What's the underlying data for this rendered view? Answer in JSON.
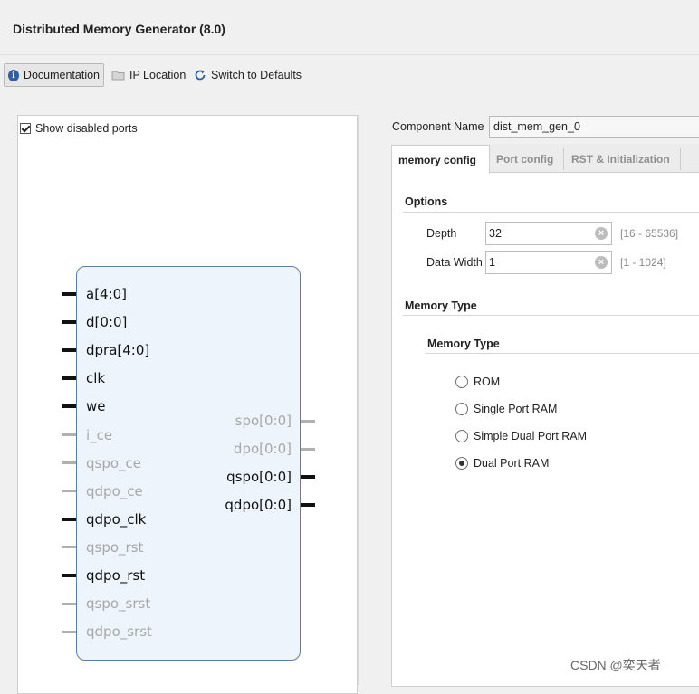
{
  "title": "Distributed Memory Generator (8.0)",
  "toolbar": {
    "documentation": "Documentation",
    "ip_location": "IP Location",
    "switch_defaults": "Switch to Defaults"
  },
  "left": {
    "show_disabled_ports": "Show disabled ports",
    "left_pins": [
      {
        "label": "a[4:0]",
        "enabled": true
      },
      {
        "label": "d[0:0]",
        "enabled": true
      },
      {
        "label": "dpra[4:0]",
        "enabled": true
      },
      {
        "label": "clk",
        "enabled": true
      },
      {
        "label": "we",
        "enabled": true
      },
      {
        "label": "i_ce",
        "enabled": false
      },
      {
        "label": "qspo_ce",
        "enabled": false
      },
      {
        "label": "qdpo_ce",
        "enabled": false
      },
      {
        "label": "qdpo_clk",
        "enabled": true
      },
      {
        "label": "qspo_rst",
        "enabled": false
      },
      {
        "label": "qdpo_rst",
        "enabled": true
      },
      {
        "label": "qspo_srst",
        "enabled": false
      },
      {
        "label": "qdpo_srst",
        "enabled": false
      }
    ],
    "right_pins": [
      {
        "label": "spo[0:0]",
        "enabled": false
      },
      {
        "label": "dpo[0:0]",
        "enabled": false
      },
      {
        "label": "qspo[0:0]",
        "enabled": true
      },
      {
        "label": "qdpo[0:0]",
        "enabled": true
      }
    ]
  },
  "component": {
    "label": "Component Name",
    "value": "dist_mem_gen_0"
  },
  "tabs": [
    "memory config",
    "Port config",
    "RST & Initialization"
  ],
  "options": {
    "header": "Options",
    "depth_label": "Depth",
    "depth_value": "32",
    "depth_range": "[16 - 65536]",
    "width_label": "Data Width",
    "width_value": "1",
    "width_range": "[1 - 1024]"
  },
  "memory_type": {
    "header": "Memory Type",
    "subheader": "Memory Type",
    "options": [
      "ROM",
      "Single Port RAM",
      "Simple Dual Port RAM",
      "Dual Port RAM"
    ],
    "selected": "Dual Port RAM"
  },
  "watermark": "CSDN @奕天者"
}
